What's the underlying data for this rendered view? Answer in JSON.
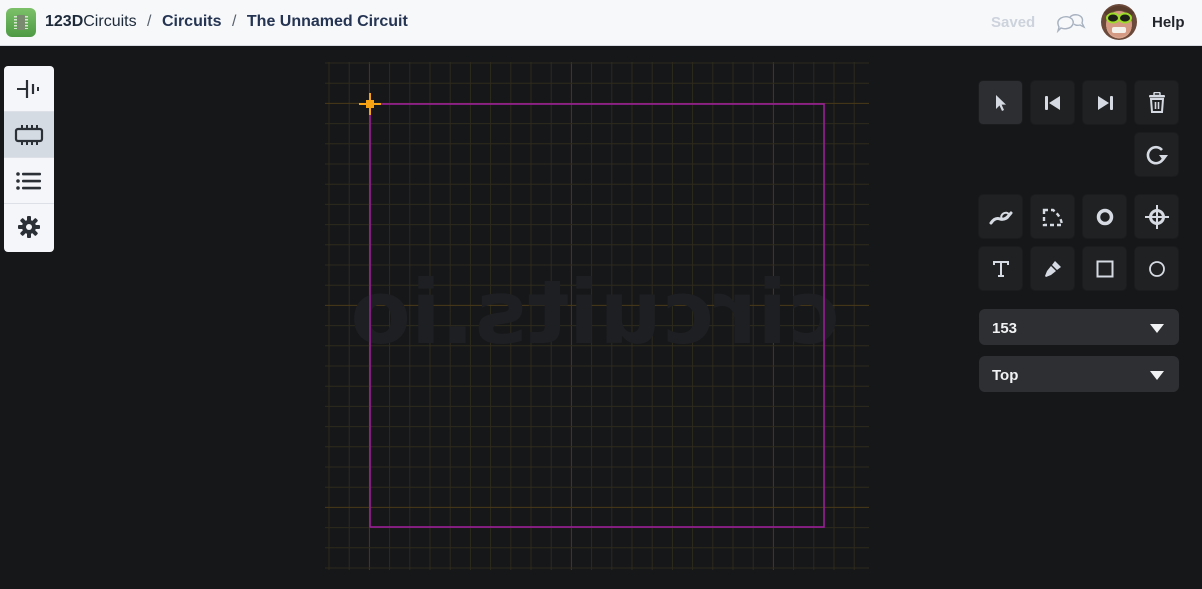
{
  "header": {
    "brand_bold": "123D",
    "brand_light": "Circuits",
    "separator": "/",
    "breadcrumb": [
      "Circuits",
      "The Unnamed Circuit"
    ],
    "save_status": "Saved",
    "help_label": "Help",
    "icons": {
      "logo": "chip-logo-icon",
      "comments": "comments-icon",
      "avatar": "user-avatar"
    }
  },
  "left_toolbar": {
    "items": [
      {
        "name": "schematic-view",
        "icon": "battery-symbol-icon",
        "active": false
      },
      {
        "name": "pcb-view",
        "icon": "chip-icon",
        "active": true
      },
      {
        "name": "components-list",
        "icon": "list-icon",
        "active": false
      },
      {
        "name": "settings",
        "icon": "gear-icon",
        "active": false
      }
    ]
  },
  "canvas": {
    "watermark": "circuits.io",
    "watermark_mirrored": true,
    "colors": {
      "background": "#161719",
      "grid_minor": "#2e2a1c",
      "grid_major": "#4a3a18",
      "board_outline": "#9a1e98",
      "origin_marker": "#f5a214"
    }
  },
  "right_toolbar": {
    "row1": [
      {
        "name": "select-tool",
        "icon": "pointer-icon",
        "active": true
      },
      {
        "name": "previous",
        "icon": "skip-back-icon"
      },
      {
        "name": "next",
        "icon": "skip-forward-icon"
      },
      {
        "name": "delete",
        "icon": "trash-icon"
      }
    ],
    "row2": [
      {
        "name": "rotate",
        "icon": "rotate-icon"
      }
    ],
    "row3": [
      {
        "name": "trace-tool",
        "icon": "trace-icon"
      },
      {
        "name": "board-outline-tool",
        "icon": "dashed-outline-icon"
      },
      {
        "name": "via-tool",
        "icon": "via-ring-icon"
      },
      {
        "name": "drill-hole-tool",
        "icon": "crosshair-icon"
      }
    ],
    "row4": [
      {
        "name": "text-tool",
        "icon": "text-icon"
      },
      {
        "name": "pen-tool",
        "icon": "pen-icon"
      },
      {
        "name": "rectangle-tool",
        "icon": "square-icon"
      },
      {
        "name": "circle-tool",
        "icon": "circle-icon"
      }
    ],
    "dropdowns": [
      {
        "name": "grid-size-select",
        "value": "153"
      },
      {
        "name": "layer-select",
        "value": "Top"
      }
    ]
  }
}
